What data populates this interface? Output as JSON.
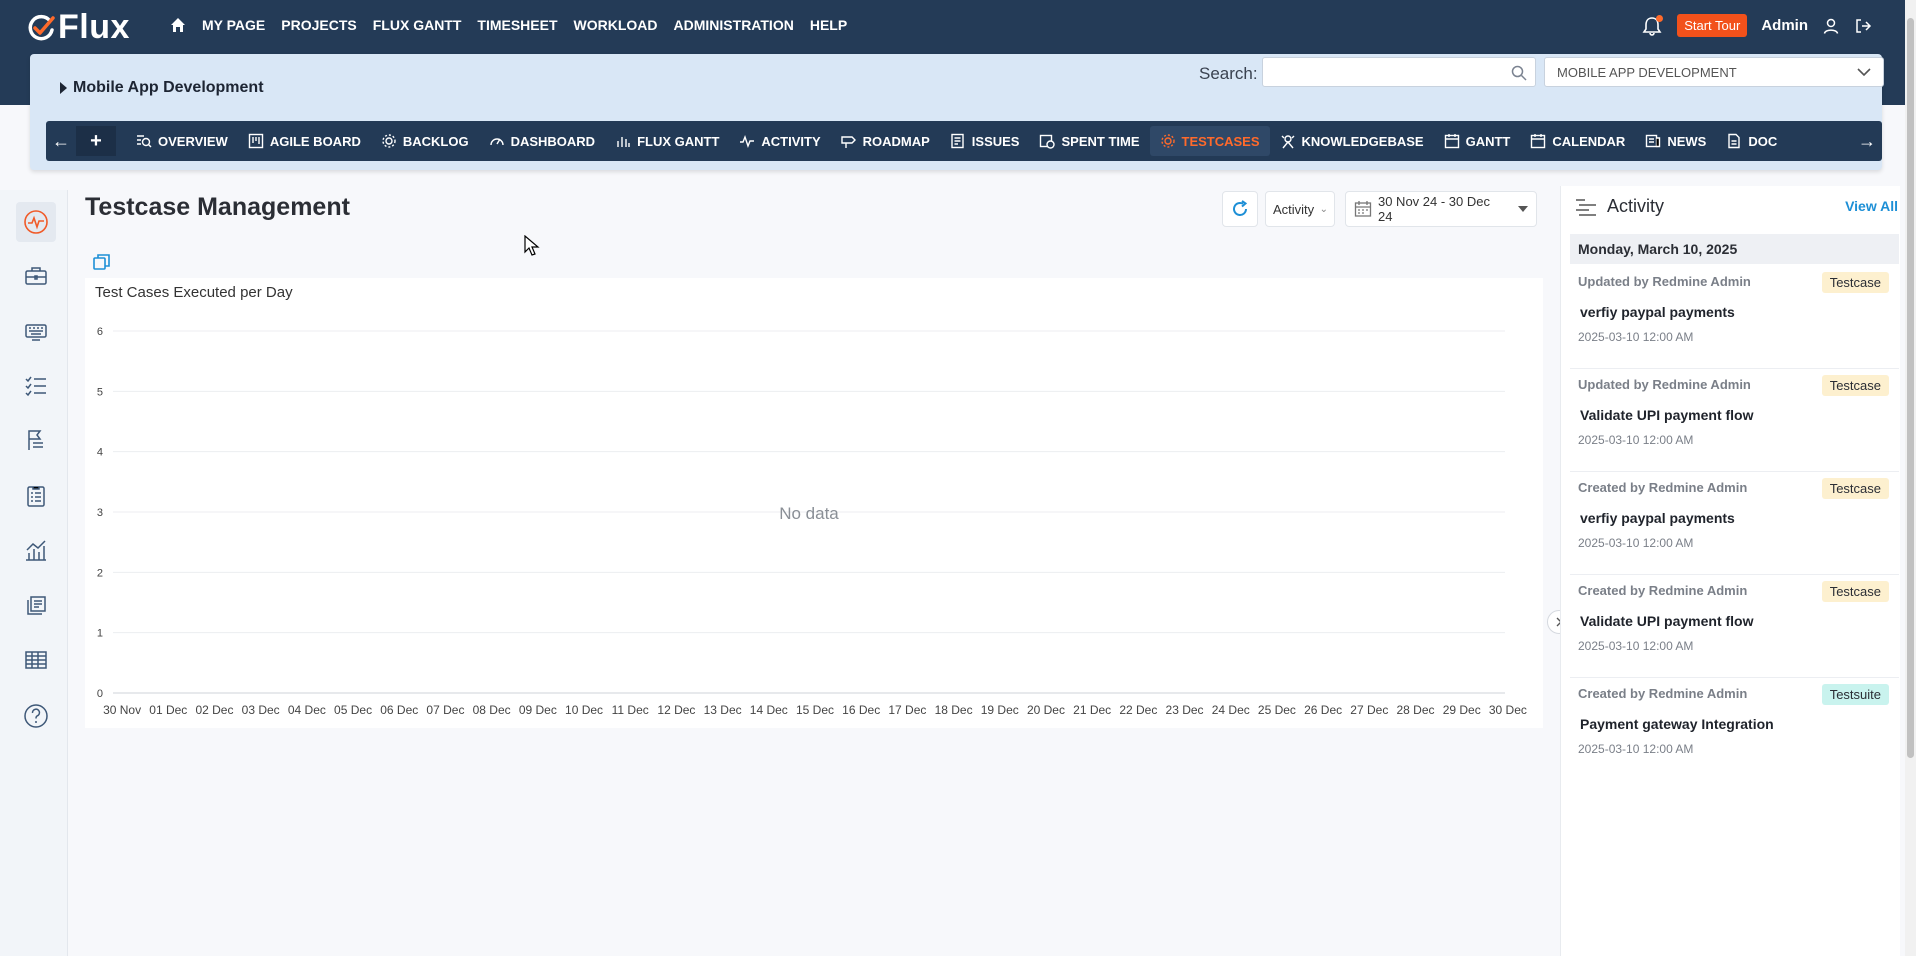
{
  "app": {
    "logo_text": "Flux"
  },
  "topnav": {
    "items": [
      "MY PAGE",
      "PROJECTS",
      "FLUX GANTT",
      "TIMESHEET",
      "WORKLOAD",
      "ADMINISTRATION",
      "HELP"
    ],
    "start_tour": "Start Tour",
    "user": "Admin"
  },
  "project": {
    "name": "Mobile App Development",
    "search_label": "Search:",
    "search_value": "",
    "selected_project": "MOBILE APP DEVELOPMENT"
  },
  "subnav": {
    "items": [
      "OVERVIEW",
      "AGILE BOARD",
      "BACKLOG",
      "DASHBOARD",
      "FLUX GANTT",
      "ACTIVITY",
      "ROADMAP",
      "ISSUES",
      "SPENT TIME",
      "TESTCASES",
      "KNOWLEDGEBASE",
      "GANTT",
      "CALENDAR",
      "NEWS",
      "DOC"
    ],
    "active": "TESTCASES"
  },
  "main": {
    "title": "Testcase Management",
    "filter": "Activity",
    "date_range": "30 Nov 24 - 30 Dec 24"
  },
  "chart_data": {
    "type": "bar",
    "title": "Test Cases Executed per Day",
    "categories": [
      "30 Nov",
      "01 Dec",
      "02 Dec",
      "03 Dec",
      "04 Dec",
      "05 Dec",
      "06 Dec",
      "07 Dec",
      "08 Dec",
      "09 Dec",
      "10 Dec",
      "11 Dec",
      "12 Dec",
      "13 Dec",
      "14 Dec",
      "15 Dec",
      "16 Dec",
      "17 Dec",
      "18 Dec",
      "19 Dec",
      "20 Dec",
      "21 Dec",
      "22 Dec",
      "23 Dec",
      "24 Dec",
      "25 Dec",
      "26 Dec",
      "27 Dec",
      "28 Dec",
      "29 Dec",
      "30 Dec"
    ],
    "values": [],
    "yticks": [
      "0",
      "1",
      "2",
      "3",
      "4",
      "5",
      "6"
    ],
    "ylim": [
      0,
      6
    ],
    "grid": true,
    "empty_text": "No data"
  },
  "activity": {
    "title": "Activity",
    "view_all": "View All",
    "date": "Monday, March 10, 2025",
    "entries": [
      {
        "by": "Updated by Redmine Admin",
        "tag": "Testcase",
        "title": "verfiy paypal payments",
        "time": "2025-03-10 12:00 AM"
      },
      {
        "by": "Updated by Redmine Admin",
        "tag": "Testcase",
        "title": "Validate UPI payment flow",
        "time": "2025-03-10 12:00 AM"
      },
      {
        "by": "Created by Redmine Admin",
        "tag": "Testcase",
        "title": "verfiy paypal payments",
        "time": "2025-03-10 12:00 AM"
      },
      {
        "by": "Created by Redmine Admin",
        "tag": "Testcase",
        "title": "Validate UPI payment flow",
        "time": "2025-03-10 12:00 AM"
      },
      {
        "by": "Created by Redmine Admin",
        "tag": "Testsuite",
        "title": "Payment gateway Integration",
        "time": "2025-03-10 12:00 AM"
      }
    ]
  }
}
